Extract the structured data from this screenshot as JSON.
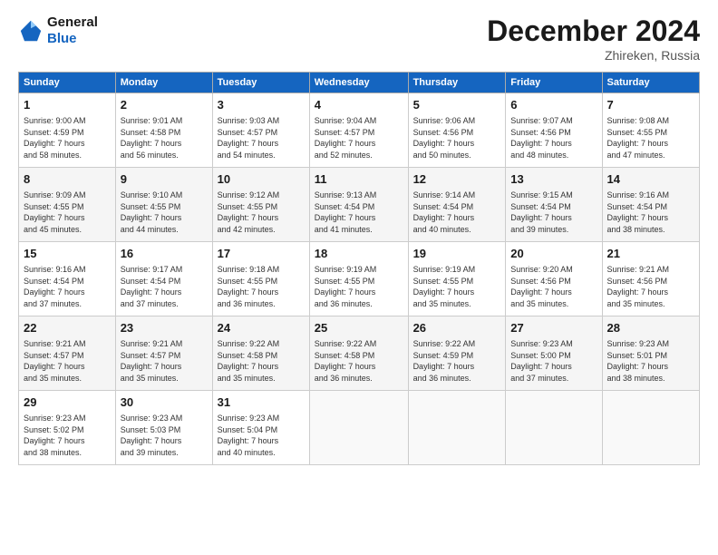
{
  "header": {
    "logo_line1": "General",
    "logo_line2": "Blue",
    "month": "December 2024",
    "location": "Zhireken, Russia"
  },
  "days_of_week": [
    "Sunday",
    "Monday",
    "Tuesday",
    "Wednesday",
    "Thursday",
    "Friday",
    "Saturday"
  ],
  "weeks": [
    [
      {
        "day": "1",
        "info": "Sunrise: 9:00 AM\nSunset: 4:59 PM\nDaylight: 7 hours\nand 58 minutes."
      },
      {
        "day": "2",
        "info": "Sunrise: 9:01 AM\nSunset: 4:58 PM\nDaylight: 7 hours\nand 56 minutes."
      },
      {
        "day": "3",
        "info": "Sunrise: 9:03 AM\nSunset: 4:57 PM\nDaylight: 7 hours\nand 54 minutes."
      },
      {
        "day": "4",
        "info": "Sunrise: 9:04 AM\nSunset: 4:57 PM\nDaylight: 7 hours\nand 52 minutes."
      },
      {
        "day": "5",
        "info": "Sunrise: 9:06 AM\nSunset: 4:56 PM\nDaylight: 7 hours\nand 50 minutes."
      },
      {
        "day": "6",
        "info": "Sunrise: 9:07 AM\nSunset: 4:56 PM\nDaylight: 7 hours\nand 48 minutes."
      },
      {
        "day": "7",
        "info": "Sunrise: 9:08 AM\nSunset: 4:55 PM\nDaylight: 7 hours\nand 47 minutes."
      }
    ],
    [
      {
        "day": "8",
        "info": "Sunrise: 9:09 AM\nSunset: 4:55 PM\nDaylight: 7 hours\nand 45 minutes."
      },
      {
        "day": "9",
        "info": "Sunrise: 9:10 AM\nSunset: 4:55 PM\nDaylight: 7 hours\nand 44 minutes."
      },
      {
        "day": "10",
        "info": "Sunrise: 9:12 AM\nSunset: 4:55 PM\nDaylight: 7 hours\nand 42 minutes."
      },
      {
        "day": "11",
        "info": "Sunrise: 9:13 AM\nSunset: 4:54 PM\nDaylight: 7 hours\nand 41 minutes."
      },
      {
        "day": "12",
        "info": "Sunrise: 9:14 AM\nSunset: 4:54 PM\nDaylight: 7 hours\nand 40 minutes."
      },
      {
        "day": "13",
        "info": "Sunrise: 9:15 AM\nSunset: 4:54 PM\nDaylight: 7 hours\nand 39 minutes."
      },
      {
        "day": "14",
        "info": "Sunrise: 9:16 AM\nSunset: 4:54 PM\nDaylight: 7 hours\nand 38 minutes."
      }
    ],
    [
      {
        "day": "15",
        "info": "Sunrise: 9:16 AM\nSunset: 4:54 PM\nDaylight: 7 hours\nand 37 minutes."
      },
      {
        "day": "16",
        "info": "Sunrise: 9:17 AM\nSunset: 4:54 PM\nDaylight: 7 hours\nand 37 minutes."
      },
      {
        "day": "17",
        "info": "Sunrise: 9:18 AM\nSunset: 4:55 PM\nDaylight: 7 hours\nand 36 minutes."
      },
      {
        "day": "18",
        "info": "Sunrise: 9:19 AM\nSunset: 4:55 PM\nDaylight: 7 hours\nand 36 minutes."
      },
      {
        "day": "19",
        "info": "Sunrise: 9:19 AM\nSunset: 4:55 PM\nDaylight: 7 hours\nand 35 minutes."
      },
      {
        "day": "20",
        "info": "Sunrise: 9:20 AM\nSunset: 4:56 PM\nDaylight: 7 hours\nand 35 minutes."
      },
      {
        "day": "21",
        "info": "Sunrise: 9:21 AM\nSunset: 4:56 PM\nDaylight: 7 hours\nand 35 minutes."
      }
    ],
    [
      {
        "day": "22",
        "info": "Sunrise: 9:21 AM\nSunset: 4:57 PM\nDaylight: 7 hours\nand 35 minutes."
      },
      {
        "day": "23",
        "info": "Sunrise: 9:21 AM\nSunset: 4:57 PM\nDaylight: 7 hours\nand 35 minutes."
      },
      {
        "day": "24",
        "info": "Sunrise: 9:22 AM\nSunset: 4:58 PM\nDaylight: 7 hours\nand 35 minutes."
      },
      {
        "day": "25",
        "info": "Sunrise: 9:22 AM\nSunset: 4:58 PM\nDaylight: 7 hours\nand 36 minutes."
      },
      {
        "day": "26",
        "info": "Sunrise: 9:22 AM\nSunset: 4:59 PM\nDaylight: 7 hours\nand 36 minutes."
      },
      {
        "day": "27",
        "info": "Sunrise: 9:23 AM\nSunset: 5:00 PM\nDaylight: 7 hours\nand 37 minutes."
      },
      {
        "day": "28",
        "info": "Sunrise: 9:23 AM\nSunset: 5:01 PM\nDaylight: 7 hours\nand 38 minutes."
      }
    ],
    [
      {
        "day": "29",
        "info": "Sunrise: 9:23 AM\nSunset: 5:02 PM\nDaylight: 7 hours\nand 38 minutes."
      },
      {
        "day": "30",
        "info": "Sunrise: 9:23 AM\nSunset: 5:03 PM\nDaylight: 7 hours\nand 39 minutes."
      },
      {
        "day": "31",
        "info": "Sunrise: 9:23 AM\nSunset: 5:04 PM\nDaylight: 7 hours\nand 40 minutes."
      },
      {
        "day": "",
        "info": ""
      },
      {
        "day": "",
        "info": ""
      },
      {
        "day": "",
        "info": ""
      },
      {
        "day": "",
        "info": ""
      }
    ]
  ]
}
